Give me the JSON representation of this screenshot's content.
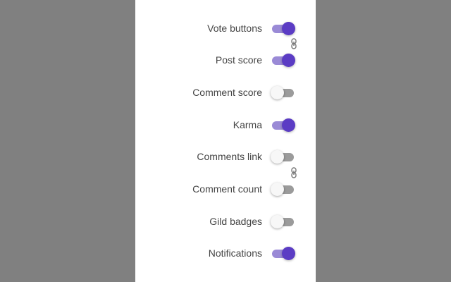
{
  "settings": [
    {
      "label": "Vote buttons",
      "enabled": true
    },
    {
      "label": "Post score",
      "enabled": true
    },
    {
      "label": "Comment score",
      "enabled": false
    },
    {
      "label": "Karma",
      "enabled": true
    },
    {
      "label": "Comments link",
      "enabled": false
    },
    {
      "label": "Comment count",
      "enabled": false
    },
    {
      "label": "Gild badges",
      "enabled": false
    },
    {
      "label": "Notifications",
      "enabled": true
    }
  ],
  "links": [
    {
      "icon": "link-icon",
      "between": [
        "Vote buttons",
        "Post score"
      ]
    },
    {
      "icon": "link-icon",
      "between": [
        "Comments link",
        "Comment count"
      ]
    }
  ],
  "colors": {
    "backdrop": "#808080",
    "panel": "#ffffff",
    "accent": "#5b3cc4",
    "accent_track": "#9a8ad6",
    "off_track": "#9b9b9b",
    "off_thumb": "#f7f7f7",
    "label": "#444444"
  }
}
